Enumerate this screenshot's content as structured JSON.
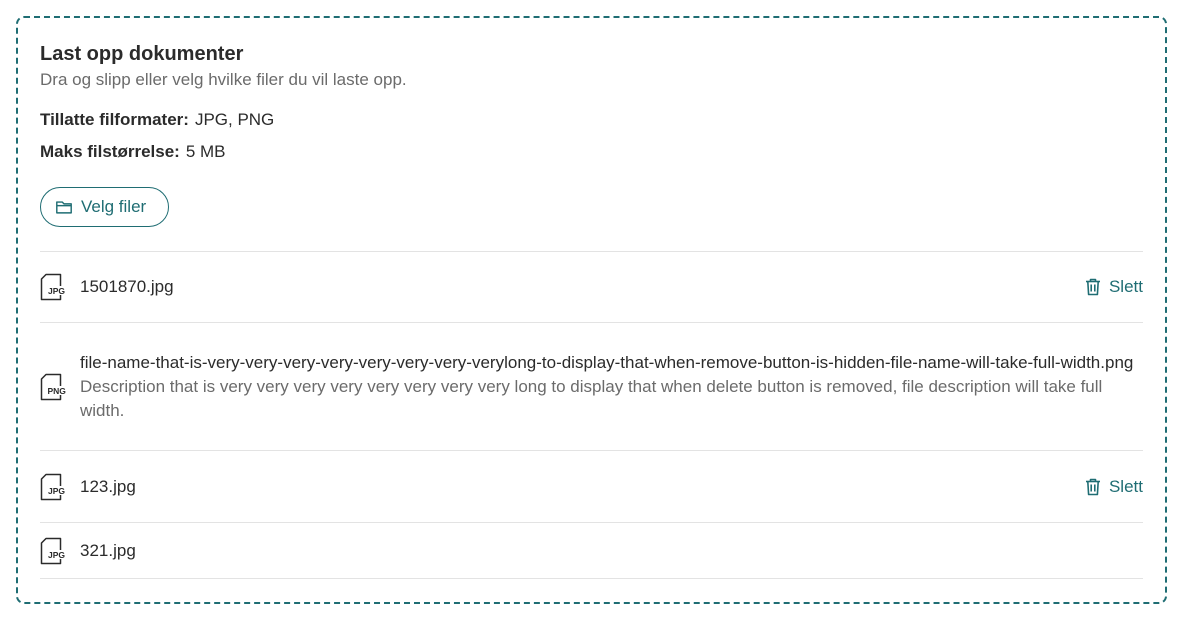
{
  "upload": {
    "title": "Last opp dokumenter",
    "subtitle": "Dra og slipp eller velg hvilke filer du vil laste opp.",
    "formats_label": "Tillatte filformater:",
    "formats_value": "JPG, PNG",
    "maxsize_label": "Maks filstørrelse:",
    "maxsize_value": "5 MB",
    "choose_button": "Velg filer"
  },
  "files": [
    {
      "type": "JPG",
      "name": "1501870.jpg",
      "description": "",
      "delete_label": "Slett"
    },
    {
      "type": "PNG",
      "name": "file-name-that-is-very-very-very-very-very-very-very-verylong-to-display-that-when-remove-button-is-hidden-file-name-will-take-full-width.png",
      "description": "Description that is very very very very very very very very long to display that when delete button is removed, file description will take full width.",
      "delete_label": ""
    },
    {
      "type": "JPG",
      "name": "123.jpg",
      "description": "",
      "delete_label": "Slett"
    },
    {
      "type": "JPG",
      "name": "321.jpg",
      "description": "",
      "delete_label": ""
    }
  ],
  "colors": {
    "accent": "#1f6d73",
    "text": "#2b2b2b",
    "muted": "#6b6b6b",
    "divider": "#e3e3e3"
  },
  "icons": {
    "choose": "folder-icon",
    "delete": "trash-icon",
    "file": "file-type-icon"
  }
}
